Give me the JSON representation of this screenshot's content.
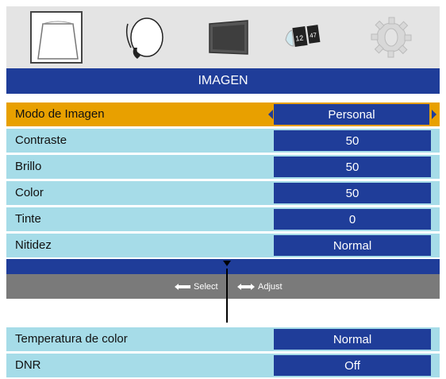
{
  "icons": [
    "picture-icon",
    "lamp-icon",
    "display-icon",
    "calendar-icon",
    "gear-icon"
  ],
  "title": "IMAGEN",
  "menu": [
    {
      "label": "Modo de Imagen",
      "value": "Personal"
    },
    {
      "label": "Contraste",
      "value": "50"
    },
    {
      "label": "Brillo",
      "value": "50"
    },
    {
      "label": "Color",
      "value": "50"
    },
    {
      "label": "Tinte",
      "value": "0"
    },
    {
      "label": "Nitidez",
      "value": "Normal"
    }
  ],
  "hints": {
    "select": "Select",
    "adjust": "Adjust"
  },
  "submenu": [
    {
      "label": "Temperatura de color",
      "value": "Normal"
    },
    {
      "label": "DNR",
      "value": "Off"
    }
  ],
  "colors": {
    "highlight": "#e8a000",
    "menu_blue": "#1f3d99",
    "row_bg": "#a6dce8"
  }
}
